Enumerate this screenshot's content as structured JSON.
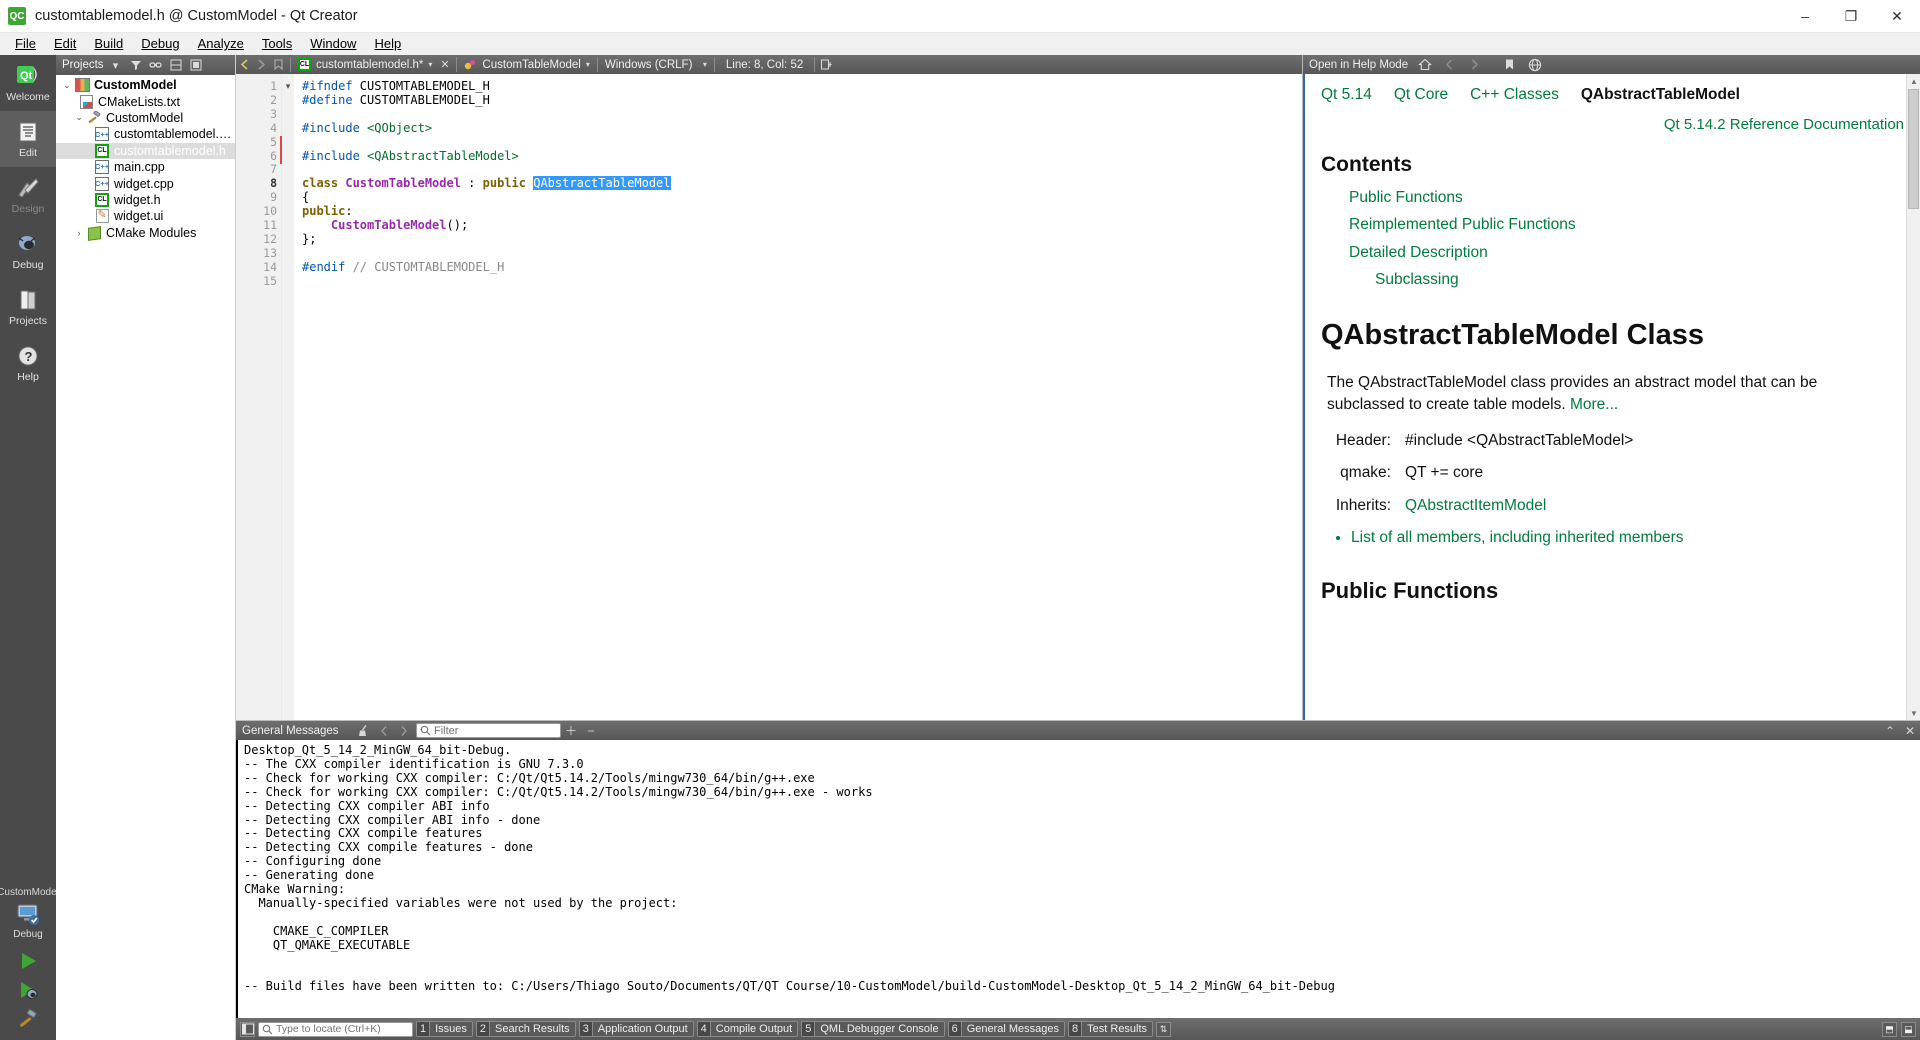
{
  "window": {
    "title": "customtablemodel.h @ CustomModel - Qt Creator",
    "app_icon": "qt-creator-icon",
    "minimize": "–",
    "maximize": "❐",
    "close": "✕"
  },
  "menubar": {
    "items": [
      {
        "label": "File"
      },
      {
        "label": "Edit"
      },
      {
        "label": "Build"
      },
      {
        "label": "Debug"
      },
      {
        "label": "Analyze"
      },
      {
        "label": "Tools"
      },
      {
        "label": "Window"
      },
      {
        "label": "Help"
      }
    ]
  },
  "modebar": {
    "modes": [
      {
        "label": "Welcome",
        "icon": "qt-logo-icon",
        "state": "normal"
      },
      {
        "label": "Edit",
        "icon": "document-lines-icon",
        "state": "active"
      },
      {
        "label": "Design",
        "icon": "paintbrush-ruler-icon",
        "state": "disabled"
      },
      {
        "label": "Debug",
        "icon": "bug-icon",
        "state": "normal"
      },
      {
        "label": "Projects",
        "icon": "book-icon",
        "state": "normal"
      },
      {
        "label": "Help",
        "icon": "question-circle-icon",
        "state": "normal"
      }
    ],
    "kit": {
      "project": "CustomModel",
      "build_config": "Debug",
      "icon": "desktop-device-icon"
    },
    "run_buttons": [
      {
        "name": "run-button",
        "icon": "play-triangle-icon"
      },
      {
        "name": "debug-button",
        "icon": "play-bug-icon"
      },
      {
        "name": "build-button",
        "icon": "hammer-icon"
      }
    ]
  },
  "sidebar": {
    "header": {
      "title": "Projects",
      "combo_caret": "▾",
      "filter_icon": "filter-icon",
      "link_icon": "link-sync-icon",
      "split_icon": "split-icon",
      "maximize_icon": "maximize-pane-icon"
    },
    "tree": [
      {
        "depth": 0,
        "arrow": "⌄",
        "icon": "project-icon",
        "label": "CustomModel",
        "bold": true,
        "selected": false
      },
      {
        "depth": 1,
        "arrow": "",
        "icon": "cmake-txt-icon",
        "label": "CMakeLists.txt",
        "bold": false,
        "selected": false
      },
      {
        "depth": 1,
        "arrow": "⌄",
        "icon": "hammer-icon",
        "label": "CustomModel",
        "bold": false,
        "selected": false
      },
      {
        "depth": 2,
        "arrow": "",
        "icon": "cpp-file-icon",
        "label": "customtablemodel.cpp",
        "bold": false,
        "selected": false
      },
      {
        "depth": 2,
        "arrow": "",
        "icon": "header-file-icon",
        "label": "customtablemodel.h",
        "bold": false,
        "selected": true
      },
      {
        "depth": 2,
        "arrow": "",
        "icon": "cpp-file-icon",
        "label": "main.cpp",
        "bold": false,
        "selected": false
      },
      {
        "depth": 2,
        "arrow": "",
        "icon": "cpp-file-icon",
        "label": "widget.cpp",
        "bold": false,
        "selected": false
      },
      {
        "depth": 2,
        "arrow": "",
        "icon": "header-file-icon",
        "label": "widget.h",
        "bold": false,
        "selected": false
      },
      {
        "depth": 2,
        "arrow": "",
        "icon": "ui-file-icon",
        "label": "widget.ui",
        "bold": false,
        "selected": false
      },
      {
        "depth": 1,
        "arrow": "›",
        "icon": "cube-icon",
        "label": "CMake Modules",
        "bold": false,
        "selected": false
      }
    ]
  },
  "editor_toolbar": {
    "back_icon": "back-arrow-icon",
    "forward_icon": "forward-arrow-icon",
    "bookmark_icon": "bookmark-icon",
    "split_icon": "split-horizontal-icon",
    "maximize_icon": "maximize-pane-icon",
    "file_combo": {
      "icon": "header-file-icon",
      "value": "customtablemodel.h*",
      "caret": "▾"
    },
    "close_icon": "✕",
    "symbol_combo": {
      "icon": "class-symbol-icon",
      "value": "CustomTableModel",
      "caret": "▾"
    },
    "lineending_combo": {
      "value": "Windows (CRLF)",
      "caret": "▾"
    },
    "cursor_position": "Line: 8, Col: 52",
    "split_button_icon": "split-pane-icon"
  },
  "code": {
    "filename": "customtablemodel.h",
    "lines": [
      {
        "n": 1,
        "fold": "",
        "changed": false,
        "tokens": [
          {
            "t": "#ifndef ",
            "c": "k-pre"
          },
          {
            "t": "CUSTOMTABLEMODEL_H",
            "c": "k-plain"
          }
        ]
      },
      {
        "n": 2,
        "fold": "",
        "changed": false,
        "tokens": [
          {
            "t": "#define ",
            "c": "k-pre"
          },
          {
            "t": "CUSTOMTABLEMODEL_H",
            "c": "k-plain"
          }
        ]
      },
      {
        "n": 3,
        "fold": "",
        "changed": false,
        "tokens": []
      },
      {
        "n": 4,
        "fold": "",
        "changed": false,
        "tokens": [
          {
            "t": "#include ",
            "c": "k-pre"
          },
          {
            "t": "<QObject>",
            "c": "k-str"
          }
        ]
      },
      {
        "n": 5,
        "fold": "",
        "changed": true,
        "tokens": []
      },
      {
        "n": 6,
        "fold": "",
        "changed": true,
        "tokens": [
          {
            "t": "#include ",
            "c": "k-pre"
          },
          {
            "t": "<QAbstractTableModel>",
            "c": "k-str"
          }
        ]
      },
      {
        "n": 7,
        "fold": "",
        "changed": false,
        "tokens": []
      },
      {
        "n": 8,
        "fold": "▾",
        "changed": false,
        "current": true,
        "tokens": [
          {
            "t": "class ",
            "c": "k-kw"
          },
          {
            "t": "CustomTableModel",
            "c": "k-typ"
          },
          {
            "t": " : ",
            "c": "k-plain"
          },
          {
            "t": "public ",
            "c": "k-kw"
          },
          {
            "t": "QAbstractTableModel",
            "c": "sel"
          }
        ]
      },
      {
        "n": 9,
        "fold": "",
        "changed": false,
        "tokens": [
          {
            "t": "{",
            "c": "k-plain"
          }
        ]
      },
      {
        "n": 10,
        "fold": "",
        "changed": false,
        "tokens": [
          {
            "t": "public",
            "c": "k-kw"
          },
          {
            "t": ":",
            "c": "k-plain"
          }
        ]
      },
      {
        "n": 11,
        "fold": "",
        "changed": false,
        "tokens": [
          {
            "t": "    ",
            "c": "k-plain"
          },
          {
            "t": "CustomTableModel",
            "c": "k-typ"
          },
          {
            "t": "();",
            "c": "k-plain"
          }
        ]
      },
      {
        "n": 12,
        "fold": "",
        "changed": false,
        "tokens": [
          {
            "t": "};",
            "c": "k-plain"
          }
        ]
      },
      {
        "n": 13,
        "fold": "",
        "changed": false,
        "tokens": []
      },
      {
        "n": 14,
        "fold": "",
        "changed": false,
        "tokens": [
          {
            "t": "#endif ",
            "c": "k-pre"
          },
          {
            "t": "// CUSTOMTABLEMODEL_H",
            "c": "k-cmt"
          }
        ]
      },
      {
        "n": 15,
        "fold": "",
        "changed": false,
        "tokens": []
      }
    ]
  },
  "help": {
    "toolbar": {
      "open_in_help_mode": "Open in Help Mode",
      "home_icon": "home-icon",
      "back_icon": "back-arrow-icon",
      "forward_icon": "forward-arrow-icon",
      "bookmark_icon": "bookmark-icon",
      "globe_icon": "globe-icon"
    },
    "breadcrumbs": [
      {
        "label": "Qt 5.14",
        "current": false
      },
      {
        "label": "Qt Core",
        "current": false
      },
      {
        "label": "C++ Classes",
        "current": false
      },
      {
        "label": "QAbstractTableModel",
        "current": true
      }
    ],
    "reference_line": "Qt 5.14.2 Reference Documentation",
    "contents_title": "Contents",
    "toc": [
      {
        "label": "Public Functions",
        "level": 1
      },
      {
        "label": "Reimplemented Public Functions",
        "level": 1
      },
      {
        "label": "Detailed Description",
        "level": 1
      },
      {
        "label": "Subclassing",
        "level": 2
      }
    ],
    "class_title": "QAbstractTableModel Class",
    "description": "The QAbstractTableModel class provides an abstract model that can be subclassed to create table models.",
    "more_link": "More...",
    "details": [
      {
        "key": "Header:",
        "value": "#include <QAbstractTableModel>",
        "link": false
      },
      {
        "key": "qmake:",
        "value": "QT += core",
        "link": false
      },
      {
        "key": "Inherits:",
        "value": "QAbstractItemModel",
        "link": true
      }
    ],
    "members_link": "List of all members, including inherited members",
    "section_title": "Public Functions"
  },
  "output": {
    "header": {
      "title": "General Messages",
      "clear_icon": "broom-clear-icon",
      "prev_icon": "prev-item-icon",
      "next_icon": "next-item-icon",
      "zoom_in_icon": "＋",
      "zoom_out_icon": "−",
      "maximize_icon": "⌃",
      "close_icon": "✕"
    },
    "filter": {
      "placeholder": "Filter",
      "value": "",
      "icon": "search-icon"
    },
    "text": "Desktop_Qt_5_14_2_MinGW_64_bit-Debug.\n-- The CXX compiler identification is GNU 7.3.0\n-- Check for working CXX compiler: C:/Qt/Qt5.14.2/Tools/mingw730_64/bin/g++.exe\n-- Check for working CXX compiler: C:/Qt/Qt5.14.2/Tools/mingw730_64/bin/g++.exe - works\n-- Detecting CXX compiler ABI info\n-- Detecting CXX compiler ABI info - done\n-- Detecting CXX compile features\n-- Detecting CXX compile features - done\n-- Configuring done\n-- Generating done\nCMake Warning:\n  Manually-specified variables were not used by the project:\n\n    CMAKE_C_COMPILER\n    QT_QMAKE_EXECUTABLE\n\n\n-- Build files have been written to: C:/Users/Thiago Souto/Documents/QT/QT Course/10-CustomModel/build-CustomModel-Desktop_Qt_5_14_2_MinGW_64_bit-Debug"
  },
  "statusbar": {
    "sidebar_toggle_icon": "sidebar-toggle-icon",
    "locator": {
      "placeholder": "Type to locate (Ctrl+K)",
      "value": "",
      "icon": "search-icon"
    },
    "tabs": [
      {
        "num": "1",
        "label": "Issues"
      },
      {
        "num": "2",
        "label": "Search Results"
      },
      {
        "num": "3",
        "label": "Application Output"
      },
      {
        "num": "4",
        "label": "Compile Output"
      },
      {
        "num": "5",
        "label": "QML Debugger Console"
      },
      {
        "num": "6",
        "label": "General Messages"
      },
      {
        "num": "8",
        "label": "Test Results"
      }
    ],
    "updown_icon": "⇅",
    "right_icons": [
      {
        "name": "show-output-icon",
        "glyph": "⬒"
      },
      {
        "name": "maximize-output-icon",
        "glyph": "⬓"
      }
    ]
  },
  "colors": {
    "chrome_dark": "#5a5a5a",
    "mode_bar": "#4a4a4a",
    "accent_green": "#007d3c",
    "selection_blue": "#3399ff",
    "help_border": "#2c6ea3"
  }
}
